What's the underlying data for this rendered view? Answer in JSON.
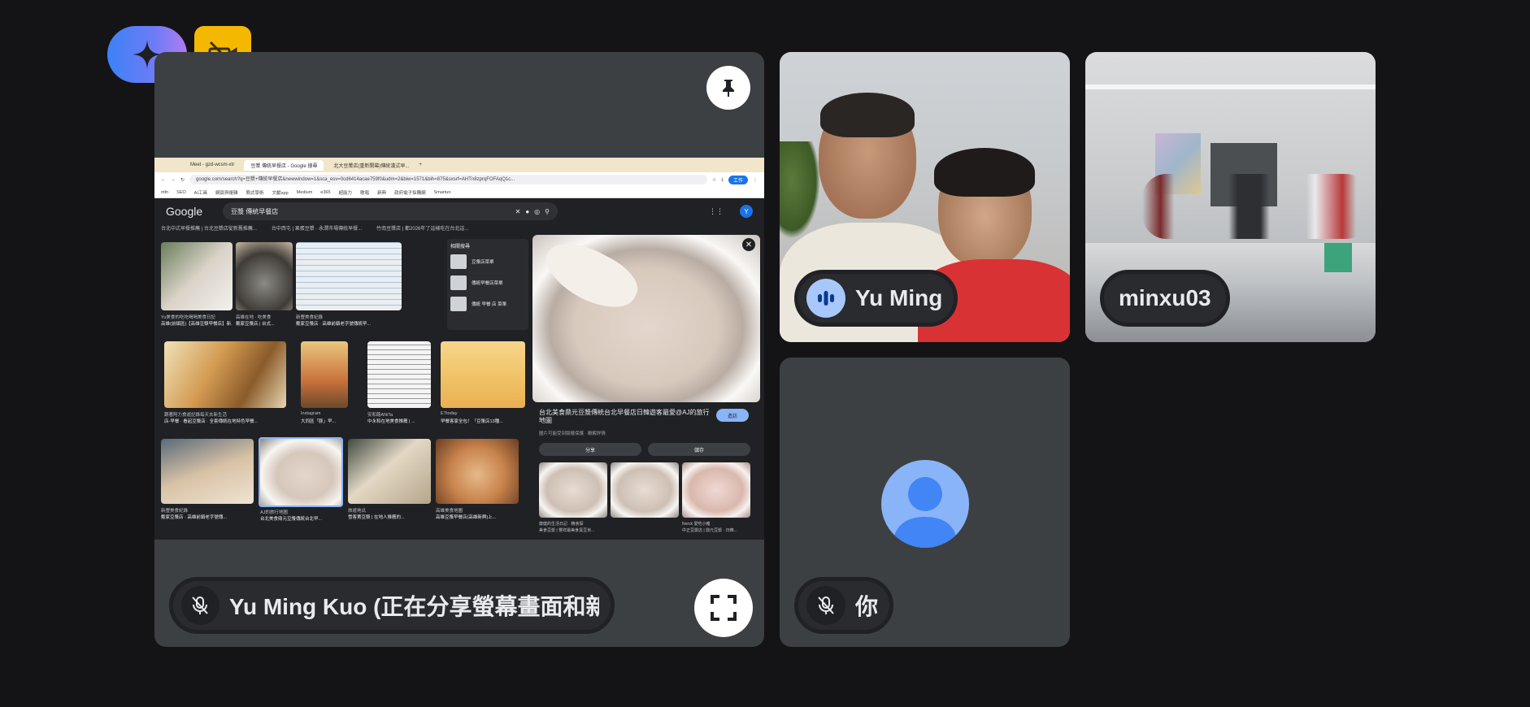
{
  "floating": {
    "gemini_icon": "sparkle-icon",
    "camera_off_icon": "camera-off-icon",
    "accent_gemini": "#4f8cf7",
    "accent_camera": "#f5b800"
  },
  "main_tile": {
    "presenter_label": "Yu Ming Kuo (正在分享螢幕畫面和新",
    "pin_icon": "pin-icon",
    "fullscreen_icon": "fullscreen-icon",
    "mic_state": "muted"
  },
  "shared_screen": {
    "tabs": [
      "Meet - gzd-wcsm-xtr",
      "豆漿 傳統早餐店 - Google 搜尋",
      "北大豆漿店(重新開幕)傳統漢式早..."
    ],
    "url": "google.com/search?q=豆漿+傳統早餐店&newwindow=1&sca_esv=0cd6414acae759f0&udm=2&biw=1571&bih=875&sxsrf=AHTn8zprqFOFAqQ1c...",
    "bookmarks": [
      "mfn",
      "SEO",
      "AI工具",
      "網頁與複雜",
      "簡式學術",
      "文獻app",
      "Medium",
      "e365",
      "超能力",
      "歌唱",
      "辭典",
      "政府電子採購網",
      "Smartun"
    ],
    "profile_chip": "工作",
    "google_logo": "Google",
    "search_query": "豆漿 傳統早餐店",
    "user_initial": "Y",
    "chips": [
      "台北中式早餐推薦 | 台北豆漿店從新舊推薦...",
      "台中西屯 | 果蛋豆漿 · 永潤市場傳統早餐...",
      "竹南豆漿店 | 都2026年了這樣吃在台北這..."
    ],
    "related": {
      "title": "相關搜尋",
      "items": [
        "豆漿店菜單",
        "傳統早餐店菜單",
        "傳統 早餐 店 菜單"
      ]
    },
    "thumb_captions": [
      {
        "source": "Yu美食的吃吃喝喝美食日記",
        "title": "高雄(前鎮區)【高雄豆漿早餐店】新..."
      },
      {
        "source": "高雄在地 · 吃美食",
        "title": "戴家豆漿店 | 台式..."
      },
      {
        "source": "新豐美食紀錄",
        "title": "戴家豆漿店 · 高雄前鎮老字號傳統早..."
      },
      {
        "source": "跟著阿力食遊記錄每天去新生活",
        "title": "店-早餐 · 看起豆漿店 · 全套傳統在地特色早餐..."
      },
      {
        "source": "Instagram",
        "title": "大同區「豚」早..."
      },
      {
        "source": "安和路ANiTa",
        "title": "中永和在地美食推薦 | ..."
      },
      {
        "source": "ETtoday",
        "title": "早餐客家全包！「豆漿店13種..."
      },
      {
        "source": "新豐美食紀錄",
        "title": "戴家豆漿店 · 高雄前鎮老字號傳..."
      },
      {
        "source": "AJ的旅行地圖",
        "title": "台北美食鼎元豆漿傳統台北早..."
      },
      {
        "source": "旅遊地瓜",
        "title": "雪客賣豆漿 | 在地人推薦的..."
      },
      {
        "source": "高雄美食地圖",
        "title": "高雄豆漿早餐店(高雄新興)上..."
      }
    ],
    "preview": {
      "title": "台北美食鼎元豆漿傳統台北早餐店日韓遊客最愛@AJ的旅行地圖",
      "subtitle": "圖片可能受到版權保護 · 瞭解詳情",
      "visit_label": "造訪",
      "share_label": "分享",
      "save_label": "儲存",
      "close_icon": "close-icon",
      "sub_captions": [
        "康健的生活日記 · 精食探",
        "",
        "Norck 愛吃小豬"
      ],
      "sub_titles": [
        "美食豆漿 | 豐祥最美食臭豆米...",
        "",
        "中正豆漿店 | 鼎元豆漿 · 日韓..."
      ]
    }
  },
  "participants": [
    {
      "name": "Yu Ming",
      "speaking": true
    },
    {
      "name": "minxu03",
      "speaking": false
    },
    {
      "name": "你",
      "muted": true
    }
  ],
  "colors": {
    "page_bg": "#141417",
    "tile_bg": "#3c4043",
    "speaking_blue": "#a8c7fa",
    "avatar_blue": "#8ab4f8",
    "avatar_dark": "#4285f4"
  }
}
